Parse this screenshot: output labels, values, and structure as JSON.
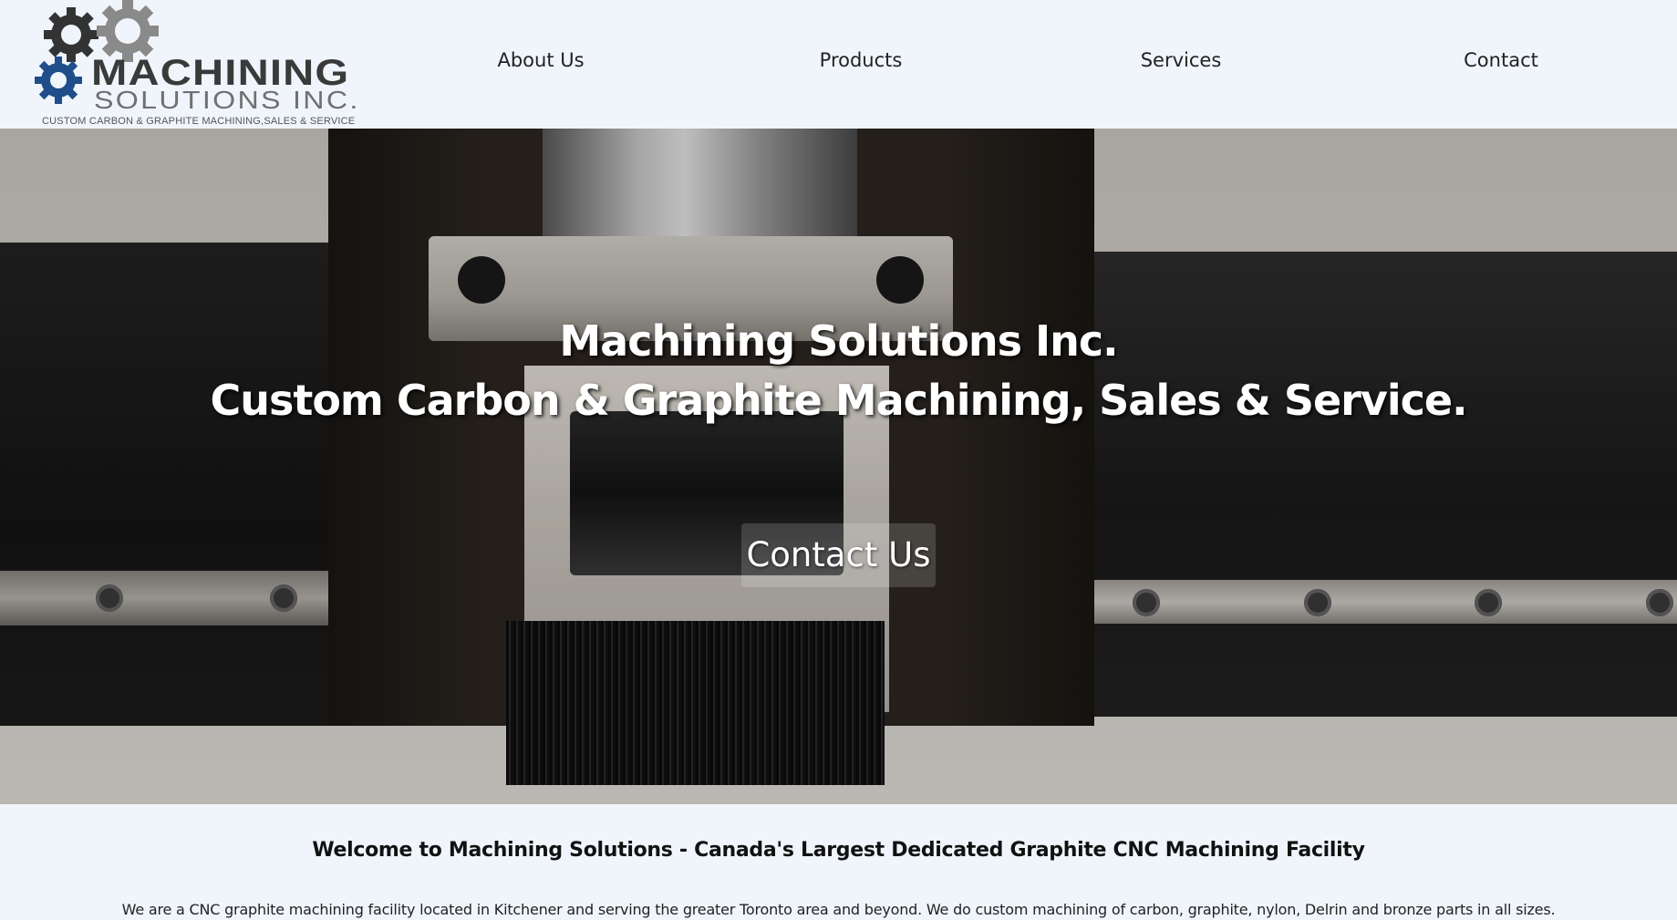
{
  "logo": {
    "wordmark_line1": "MACHINING",
    "wordmark_line2": "SOLUTIONS INC.",
    "tagline": "CUSTOM CARBON & GRAPHITE MACHINING,SALES & SERVICE",
    "gear_colors": [
      "#333333",
      "#8a8a8a",
      "#1f4e8a"
    ]
  },
  "nav": {
    "items": [
      {
        "label": "About Us"
      },
      {
        "label": "Products"
      },
      {
        "label": "Services"
      },
      {
        "label": "Contact"
      }
    ]
  },
  "hero": {
    "title_line1": "Machining Solutions Inc.",
    "title_line2": "Custom Carbon & Graphite Machining, Sales & Service.",
    "cta_label": "Contact Us"
  },
  "content": {
    "welcome_heading": "Welcome to Machining Solutions - Canada's Largest Dedicated Graphite CNC Machining Facility",
    "intro_text": "We are a CNC graphite machining facility located in Kitchener and serving the greater Toronto area and beyond. We do custom machining of carbon, graphite, nylon, Delrin and bronze parts in all sizes."
  }
}
